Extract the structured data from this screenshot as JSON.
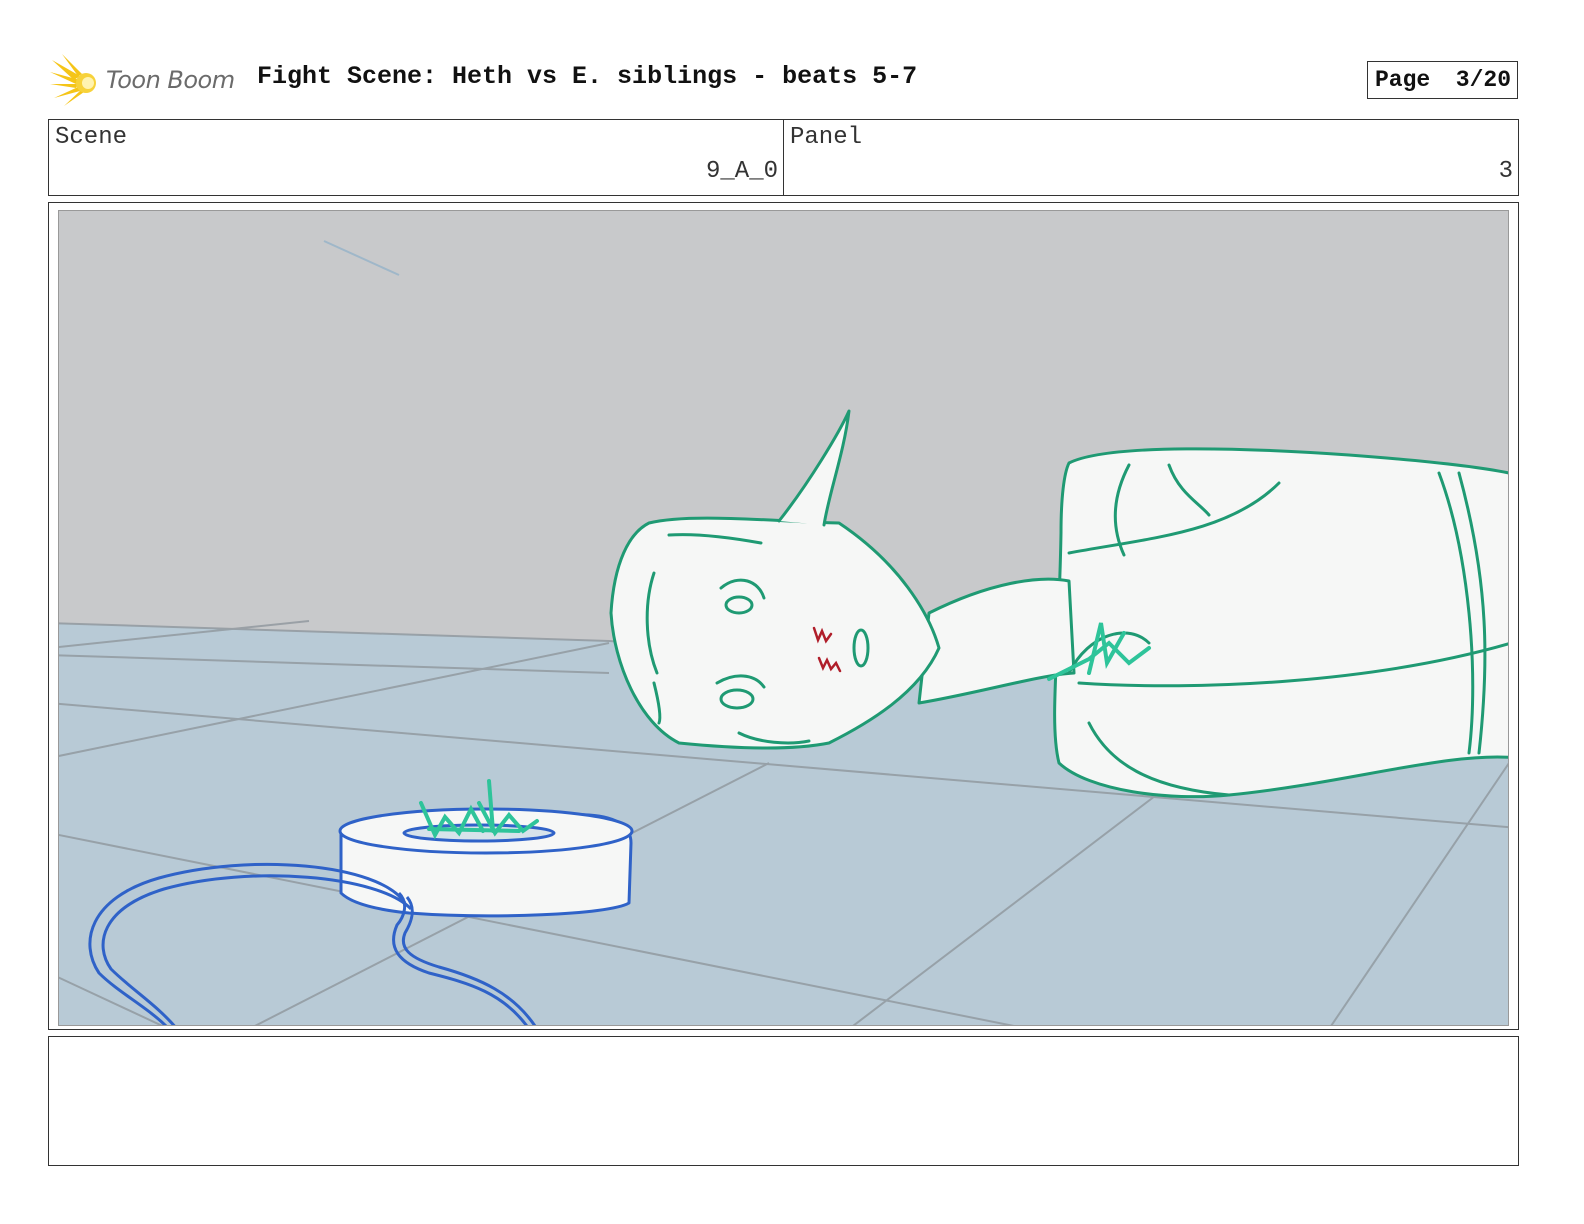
{
  "header": {
    "logo_text": "Toon Boom",
    "title": "Fight Scene: Heth vs E. siblings - beats 5-7",
    "page_label": "Page",
    "page_value": "3/20"
  },
  "info": {
    "scene_label": "Scene",
    "scene_value": "9_A_0",
    "panel_label": "Panel",
    "panel_value": "3"
  },
  "colors": {
    "character_line": "#1f9a73",
    "device_line": "#2f62c8",
    "wall": "#c8c9cb",
    "floor": "#b8cad6",
    "logo": "#f5c518"
  }
}
